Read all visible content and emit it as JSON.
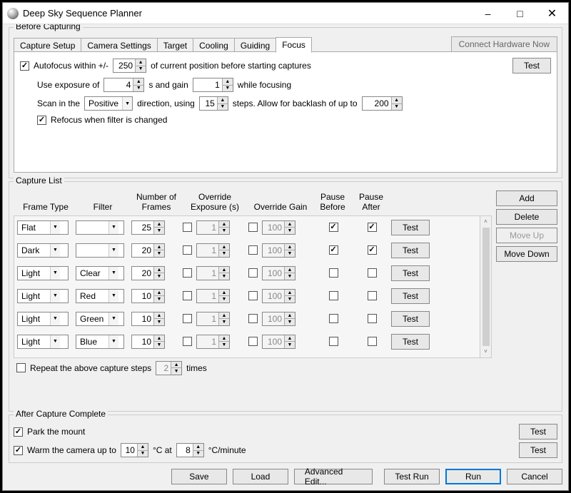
{
  "window": {
    "title": "Deep Sky Sequence Planner"
  },
  "before_capturing": {
    "label": "Before Capturing",
    "tabs": [
      "Capture Setup",
      "Camera Settings",
      "Target",
      "Cooling",
      "Guiding",
      "Focus"
    ],
    "active_tab": 5,
    "connect_button": "Connect Hardware Now",
    "focus": {
      "autofocus_checked": true,
      "autofocus_label_pre": "Autofocus within +/-",
      "autofocus_value": "250",
      "autofocus_label_post": "of current position before starting captures",
      "test_label": "Test",
      "exposure_label_pre": "Use exposure of",
      "exposure_value": "4",
      "exposure_label_mid": "s and gain",
      "gain_value": "1",
      "exposure_label_post": "while focusing",
      "scan_label_pre": "Scan in the",
      "scan_direction": "Positive",
      "scan_label_mid": "direction, using",
      "scan_steps": "15",
      "scan_label_post": "steps. Allow for backlash of up to",
      "backlash_value": "200",
      "refocus_checked": true,
      "refocus_label": "Refocus when filter is changed"
    }
  },
  "capture_list": {
    "label": "Capture List",
    "headers": {
      "frame_type": "Frame Type",
      "filter": "Filter",
      "num_frames_l1": "Number of",
      "num_frames_l2": "Frames",
      "ov_exp_l1": "Override",
      "ov_exp_l2": "Exposure (s)",
      "ov_gain": "Override Gain",
      "pause_before_l1": "Pause",
      "pause_before_l2": "Before",
      "pause_after_l1": "Pause",
      "pause_after_l2": "After"
    },
    "rows": [
      {
        "frame": "Flat",
        "filter": "",
        "num": "25",
        "ov_exp_on": false,
        "ov_exp": "1",
        "ov_gain_on": false,
        "ov_gain": "100",
        "pb": true,
        "pa": true
      },
      {
        "frame": "Dark",
        "filter": "",
        "num": "20",
        "ov_exp_on": false,
        "ov_exp": "1",
        "ov_gain_on": false,
        "ov_gain": "100",
        "pb": true,
        "pa": true
      },
      {
        "frame": "Light",
        "filter": "Clear",
        "num": "20",
        "ov_exp_on": false,
        "ov_exp": "1",
        "ov_gain_on": false,
        "ov_gain": "100",
        "pb": false,
        "pa": false
      },
      {
        "frame": "Light",
        "filter": "Red",
        "num": "10",
        "ov_exp_on": false,
        "ov_exp": "1",
        "ov_gain_on": false,
        "ov_gain": "100",
        "pb": false,
        "pa": false
      },
      {
        "frame": "Light",
        "filter": "Green",
        "num": "10",
        "ov_exp_on": false,
        "ov_exp": "1",
        "ov_gain_on": false,
        "ov_gain": "100",
        "pb": false,
        "pa": false
      },
      {
        "frame": "Light",
        "filter": "Blue",
        "num": "10",
        "ov_exp_on": false,
        "ov_exp": "1",
        "ov_gain_on": false,
        "ov_gain": "100",
        "pb": false,
        "pa": false
      }
    ],
    "test_label": "Test",
    "side_buttons": {
      "add": "Add",
      "delete": "Delete",
      "move_up": "Move Up",
      "move_down": "Move Down"
    },
    "repeat_checked": false,
    "repeat_label_pre": "Repeat the above capture steps",
    "repeat_value": "2",
    "repeat_label_post": "times"
  },
  "after_capture": {
    "label": "After Capture Complete",
    "park_checked": true,
    "park_label": "Park the mount",
    "test_label": "Test",
    "warm_checked": true,
    "warm_label_pre": "Warm the camera up to",
    "warm_target": "10",
    "warm_label_mid": "°C at",
    "warm_rate": "8",
    "warm_label_post": "°C/minute"
  },
  "bottom": {
    "save": "Save",
    "load": "Load",
    "advanced": "Advanced Edit...",
    "test_run": "Test Run",
    "run": "Run",
    "cancel": "Cancel"
  }
}
